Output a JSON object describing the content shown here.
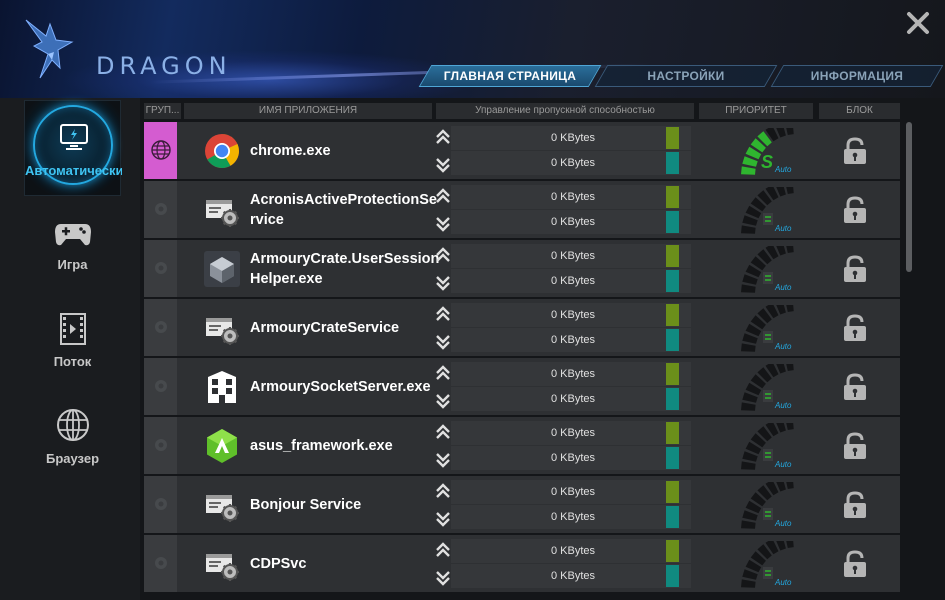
{
  "app": {
    "logo_text": "DRAGON"
  },
  "colors": {
    "accent": "#23a8e0",
    "group_selected": "#d45cd0",
    "upload_bar": "#6b8f1a",
    "download_bar": "#108a80",
    "priority_green": "#2fb52f"
  },
  "tabs": [
    {
      "label": "ГЛАВНАЯ СТРАНИЦА",
      "active": true
    },
    {
      "label": "НАСТРОЙКИ",
      "active": false
    },
    {
      "label": "ИНФОРМАЦИЯ",
      "active": false
    }
  ],
  "sidebar": {
    "active": {
      "label": "Автоматически",
      "icon": "monitor-icon"
    },
    "items": [
      {
        "label": "Игра",
        "icon": "gamepad-icon"
      },
      {
        "label": "Поток",
        "icon": "film-strip-icon"
      },
      {
        "label": "Браузер",
        "icon": "globe-icon"
      }
    ]
  },
  "columns": {
    "group": "ГРУП...",
    "app_name": "ИМЯ ПРИЛОЖЕНИЯ",
    "bandwidth": "Управление пропускной способностью",
    "priority": "ПРИОРИТЕТ",
    "block": "БЛОК"
  },
  "rows": [
    {
      "name": "chrome.exe",
      "icon": "chrome-icon",
      "up": "0 KBytes",
      "down": "0 KBytes",
      "group_selected": true,
      "priority_active": true
    },
    {
      "name": "AcronisActiveProtectionService",
      "icon": "service-gear-icon",
      "up": "0 KBytes",
      "down": "0 KBytes",
      "group_selected": false,
      "priority_active": false
    },
    {
      "name": "ArmouryCrate.UserSessionHelper.exe",
      "icon": "armoury-crate-icon",
      "up": "0 KBytes",
      "down": "0 KBytes",
      "group_selected": false,
      "priority_active": false
    },
    {
      "name": "ArmouryCrateService",
      "icon": "service-gear-icon",
      "up": "0 KBytes",
      "down": "0 KBytes",
      "group_selected": false,
      "priority_active": false
    },
    {
      "name": "ArmourySocketServer.exe",
      "icon": "building-icon",
      "up": "0 KBytes",
      "down": "0 KBytes",
      "group_selected": false,
      "priority_active": false
    },
    {
      "name": "asus_framework.exe",
      "icon": "asus-framework-icon",
      "up": "0 KBytes",
      "down": "0 KBytes",
      "group_selected": false,
      "priority_active": false
    },
    {
      "name": "Bonjour Service",
      "icon": "service-gear-icon",
      "up": "0 KBytes",
      "down": "0 KBytes",
      "group_selected": false,
      "priority_active": false
    },
    {
      "name": "CDPSvc",
      "icon": "service-gear-icon",
      "up": "0 KBytes",
      "down": "0 KBytes",
      "group_selected": false,
      "priority_active": false
    }
  ]
}
